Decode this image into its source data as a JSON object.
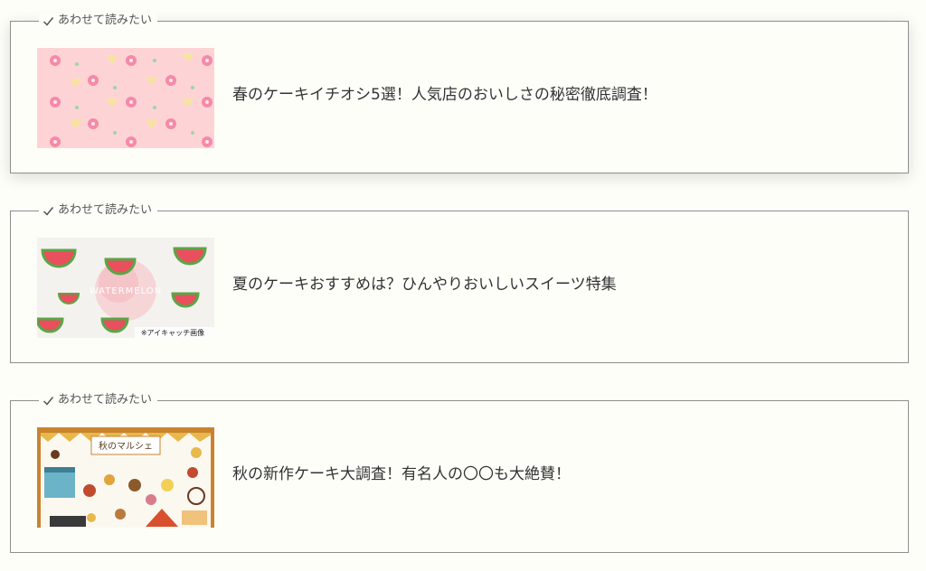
{
  "articles": [
    {
      "label": "あわせて読みたい",
      "label_icon": "check-icon",
      "title": "春のケーキイチオシ5選！人気店のおいしさの秘密徹底調査！",
      "thumbnail": "spring-flower-pattern-thumbnail"
    },
    {
      "label": "あわせて読みたい",
      "label_icon": "check-icon",
      "title": "夏のケーキおすすめは？ひんやりおいしいスイーツ特集",
      "thumbnail": "watermelon-thumbnail",
      "thumbnail_center_text": "WATERMELON",
      "thumbnail_caption": "※アイキャッチ画像"
    },
    {
      "label": "あわせて読みたい",
      "label_icon": "check-icon",
      "title": "秋の新作ケーキ大調査！有名人の〇〇も大絶賛！",
      "thumbnail": "autumn-marche-thumbnail",
      "thumbnail_sign_text": "秋のマルシェ"
    }
  ],
  "colors": {
    "background": "#fefef9",
    "border": "#8e8e8e",
    "label_text": "#555555",
    "title_text": "#333333"
  }
}
